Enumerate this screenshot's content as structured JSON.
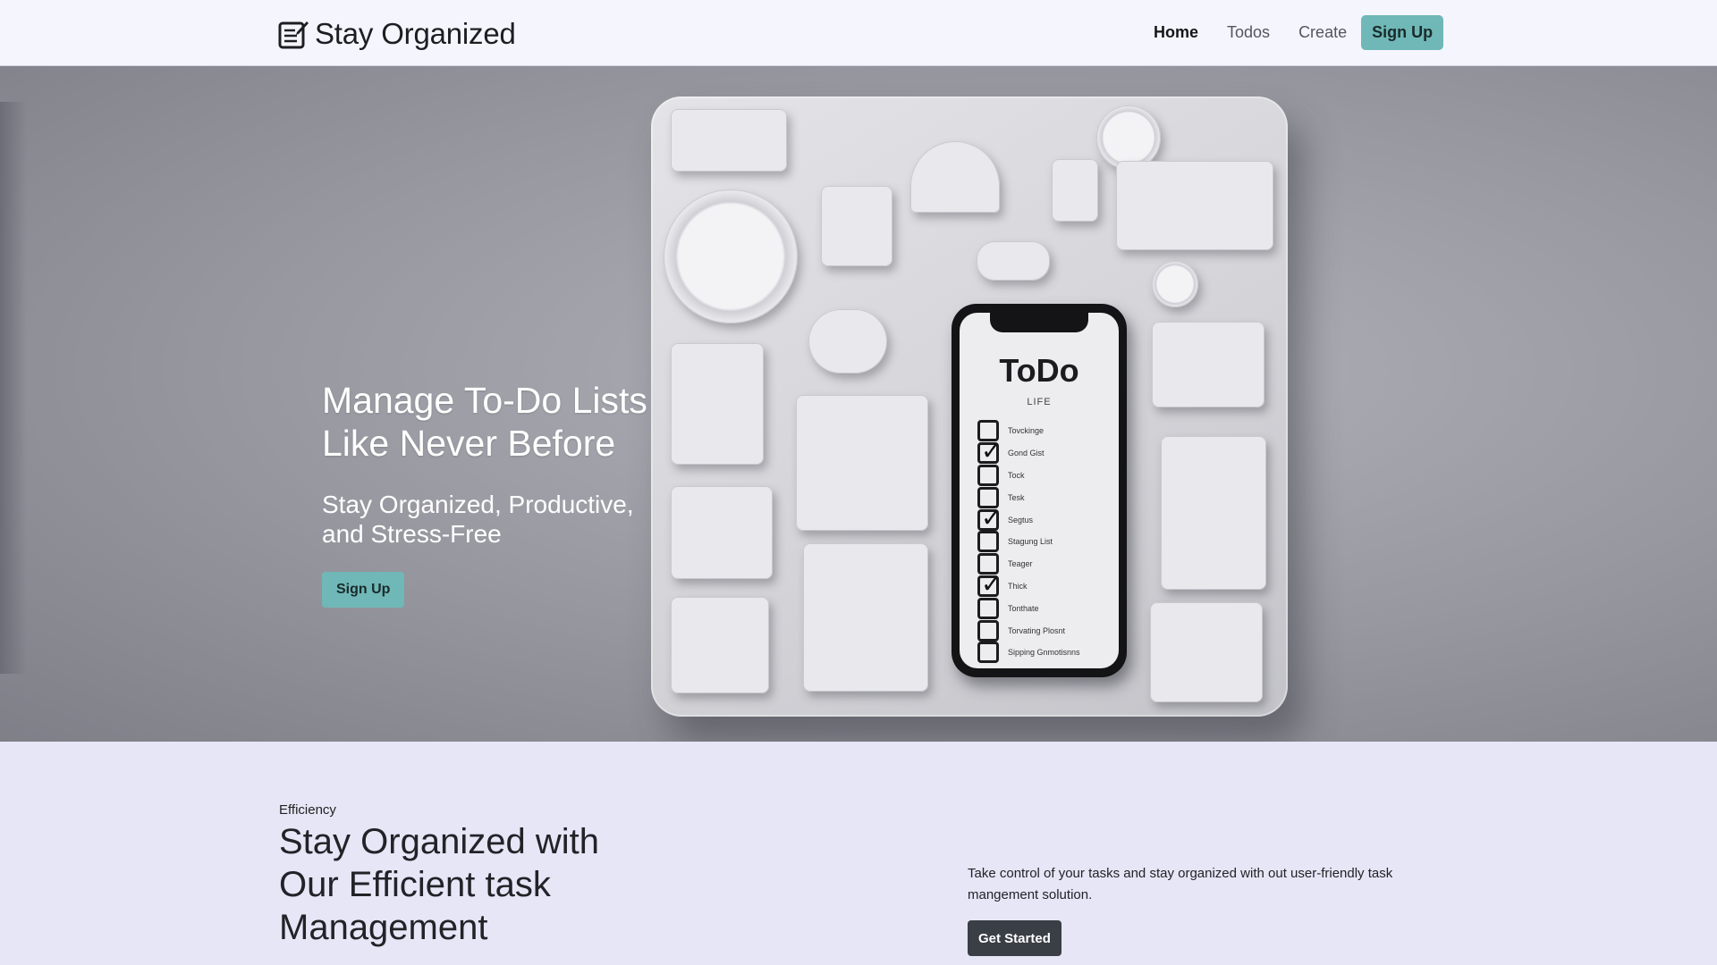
{
  "nav": {
    "brand": "Stay Organized",
    "brand_icon": "notepad-pen-icon",
    "links": [
      {
        "label": "Home",
        "active": true
      },
      {
        "label": "Todos",
        "active": false
      },
      {
        "label": "Create",
        "active": false
      }
    ],
    "signup_label": "Sign Up"
  },
  "hero": {
    "title": "Manage To-Do Lists Like Never Before",
    "subtitle": "Stay Organized, Productive, and Stress-Free",
    "signup_label": "Sign Up",
    "illustration": {
      "phone_title": "ToDo",
      "phone_subtitle": "LIFE",
      "items": [
        {
          "text": "Tovckinge",
          "checked": false
        },
        {
          "text": "Gond Gist",
          "checked": true
        },
        {
          "text": "Tock",
          "checked": false
        },
        {
          "text": "Tesk",
          "checked": false
        },
        {
          "text": "Segtus",
          "checked": true
        },
        {
          "text": "Stagung List",
          "checked": false
        },
        {
          "text": "Teager",
          "checked": false
        },
        {
          "text": "Thick",
          "checked": true
        },
        {
          "text": "Tonthate",
          "checked": false
        },
        {
          "text": "Torvating Plosnt",
          "checked": false
        },
        {
          "text": "Sipping Gnmotisnns",
          "checked": false
        }
      ]
    }
  },
  "feature": {
    "eyebrow": "Efficiency",
    "title": "Stay Organized with Our Efficient task Management",
    "description": "Take control of your tasks and stay organized with out user-friendly task mangement solution.",
    "cta_label": "Get Started"
  },
  "colors": {
    "accent": "#6fb8b7",
    "dark_button": "#3a3e45",
    "nav_bg": "#f5f5fe",
    "section_bg": "#e6e6f6"
  }
}
